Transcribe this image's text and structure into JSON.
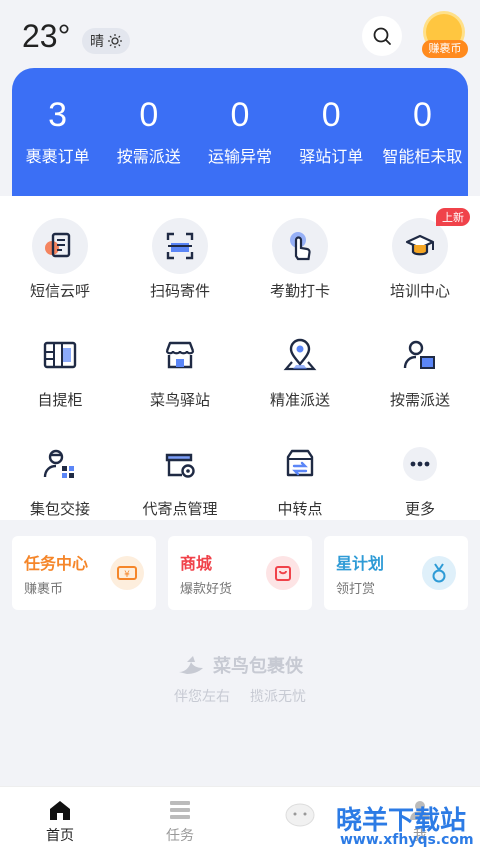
{
  "header": {
    "temperature": "23°",
    "weather": "晴",
    "coin_label": "赚裹币"
  },
  "stats": [
    {
      "value": "3",
      "label": "裹裹订单"
    },
    {
      "value": "0",
      "label": "按需派送"
    },
    {
      "value": "0",
      "label": "运输异常"
    },
    {
      "value": "0",
      "label": "驿站订单"
    },
    {
      "value": "0",
      "label": "智能柜未取"
    }
  ],
  "grid": {
    "items": [
      {
        "label": "短信云呼"
      },
      {
        "label": "扫码寄件"
      },
      {
        "label": "考勤打卡"
      },
      {
        "label": "培训中心",
        "badge": "上新"
      },
      {
        "label": "自提柜"
      },
      {
        "label": "菜鸟驿站"
      },
      {
        "label": "精准派送"
      },
      {
        "label": "按需派送"
      },
      {
        "label": "集包交接"
      },
      {
        "label": "代寄点管理"
      },
      {
        "label": "中转点"
      },
      {
        "label": "更多"
      }
    ]
  },
  "cards": [
    {
      "title": "任务中心",
      "subtitle": "赚裹币",
      "color": "#f5862a"
    },
    {
      "title": "商城",
      "subtitle": "爆款好货",
      "color": "#f0424a"
    },
    {
      "title": "星计划",
      "subtitle": "领打赏",
      "color": "#2e9bd6"
    }
  ],
  "brand": {
    "name": "菜鸟包裹侠",
    "slogan_left": "伴您左右",
    "slogan_right": "揽派无忧"
  },
  "tabs": [
    {
      "label": "首页"
    },
    {
      "label": "任务"
    },
    {
      "label": ""
    },
    {
      "label": "我"
    }
  ],
  "watermark": {
    "text": "晓羊下载站",
    "url": "www.xfhyqs.com"
  },
  "colors": {
    "primary": "#3b6ff5",
    "icon_dark": "#1f2a44",
    "accent_red": "#f0424a"
  }
}
